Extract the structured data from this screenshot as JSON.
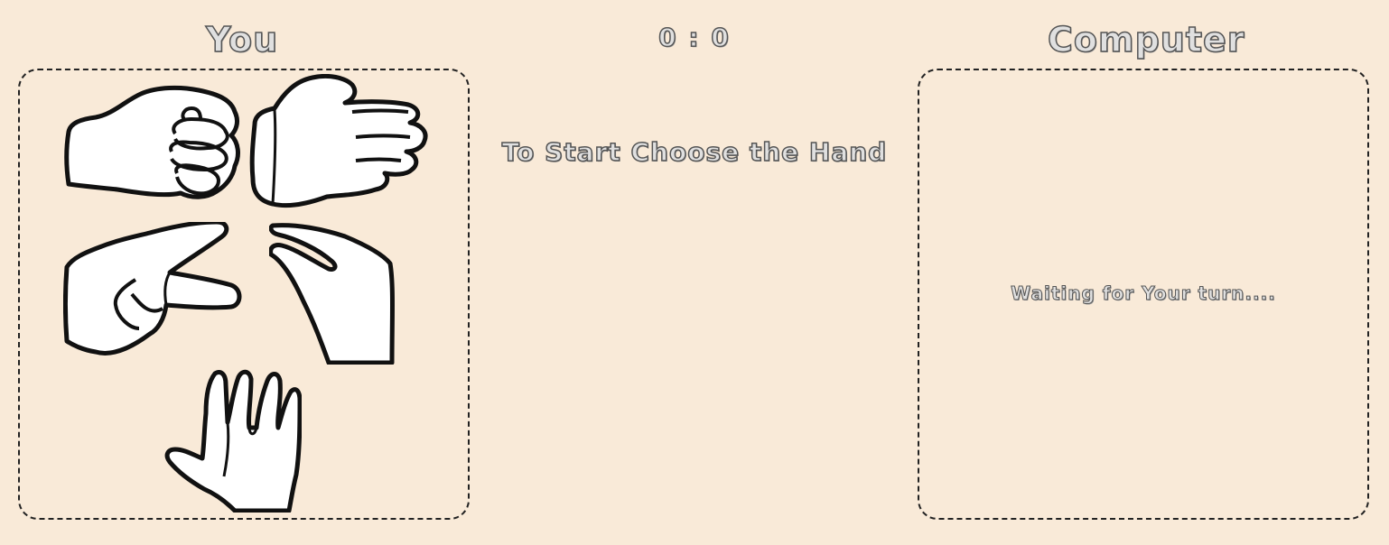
{
  "player": {
    "title": "You",
    "hands": [
      {
        "name": "rock",
        "icon": "rock-hand-icon"
      },
      {
        "name": "paper",
        "icon": "paper-hand-icon"
      },
      {
        "name": "scissors",
        "icon": "scissors-hand-icon"
      },
      {
        "name": "lizard",
        "icon": "lizard-hand-icon"
      },
      {
        "name": "spock",
        "icon": "spock-hand-icon"
      }
    ]
  },
  "score": {
    "text": "0 : 0"
  },
  "instruction": "To Start Choose the Hand",
  "computer": {
    "title": "Computer",
    "status": "Waiting for Your turn...."
  },
  "colors": {
    "background": "#f9ead8",
    "outline": "#222222",
    "hand_fill": "#ffffff"
  }
}
